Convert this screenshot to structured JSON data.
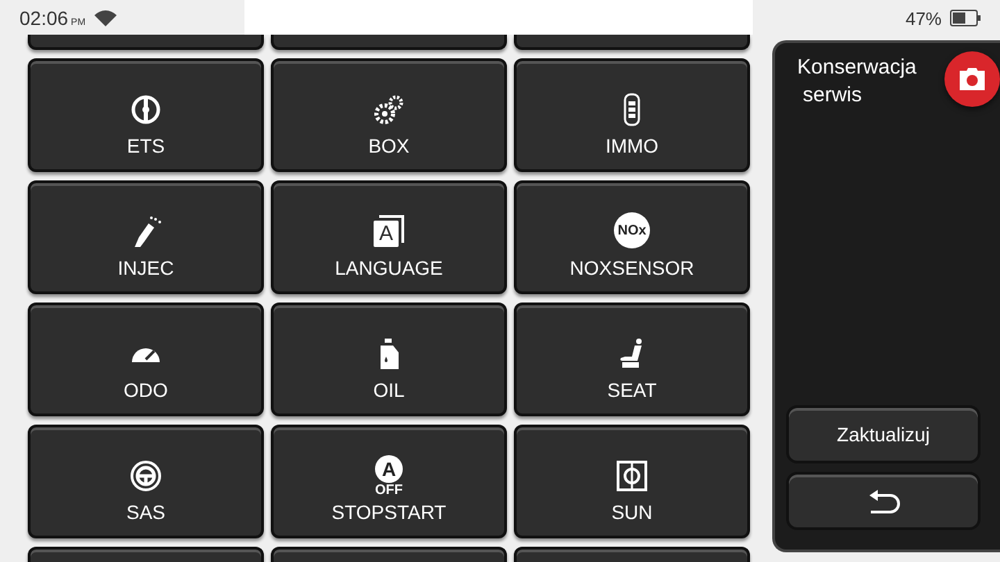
{
  "status_bar": {
    "time": "02:06",
    "ampm": "PM",
    "battery": "47%"
  },
  "tiles": [
    {
      "label": "ETS",
      "kind": "ets"
    },
    {
      "label": "BOX",
      "kind": "gears"
    },
    {
      "label": "IMMO",
      "kind": "keyfob"
    },
    {
      "label": "INJEC",
      "kind": "injector"
    },
    {
      "label": "LANGUAGE",
      "kind": "language",
      "icon_text": "A"
    },
    {
      "label": "NOXSENSOR",
      "kind": "nox",
      "icon_text": "NOx"
    },
    {
      "label": "ODO",
      "kind": "gauge"
    },
    {
      "label": "OIL",
      "kind": "oil"
    },
    {
      "label": "SEAT",
      "kind": "seat"
    },
    {
      "label": "SAS",
      "kind": "steering"
    },
    {
      "label": "STOPSTART",
      "kind": "stopstart",
      "icon_text": "A",
      "icon_subtext": "OFF"
    },
    {
      "label": "SUN",
      "kind": "sun"
    }
  ],
  "side_panel": {
    "title": "Konserwacja",
    "subtitle": "serwis",
    "update_button": "Zaktualizuj"
  }
}
